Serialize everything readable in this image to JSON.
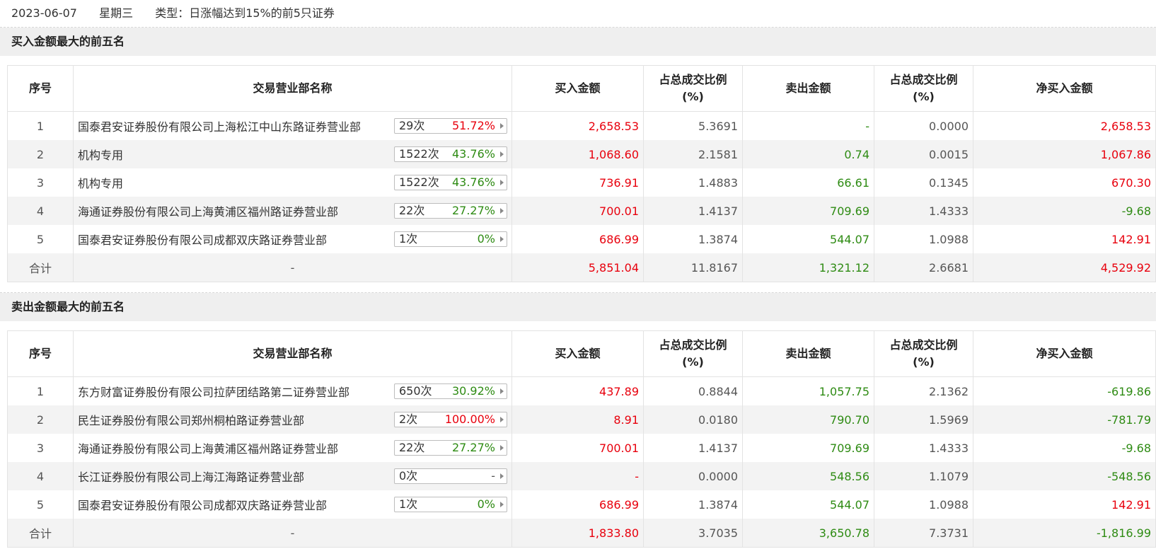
{
  "header": {
    "date": "2023-06-07",
    "weekday": "星期三",
    "type_label": "类型：日涨幅达到15%的前5只证券"
  },
  "columns": {
    "idx": "序号",
    "name": "交易营业部名称",
    "buy": "买入金额",
    "buy_ratio_1": "占总成交比例",
    "buy_ratio_2": "(%)",
    "sell": "卖出金额",
    "sell_ratio_1": "占总成交比例",
    "sell_ratio_2": "(%)",
    "net": "净买入金额"
  },
  "colors": {
    "up": "#e8000d",
    "down": "#2e8b13"
  },
  "buy_section": {
    "title": "买入金额最大的前五名",
    "rows": [
      {
        "idx": "1",
        "name": "国泰君安证券股份有限公司上海松江中山东路证券营业部",
        "count": "29次",
        "pct": "51.72%",
        "pct_color": "red",
        "buy": "2,658.53",
        "buy_ratio": "5.3691",
        "sell": "-",
        "sell_ratio": "0.0000",
        "net": "2,658.53",
        "net_color": "red"
      },
      {
        "idx": "2",
        "name": "机构专用",
        "count": "1522次",
        "pct": "43.76%",
        "pct_color": "green",
        "buy": "1,068.60",
        "buy_ratio": "2.1581",
        "sell": "0.74",
        "sell_ratio": "0.0015",
        "net": "1,067.86",
        "net_color": "red"
      },
      {
        "idx": "3",
        "name": "机构专用",
        "count": "1522次",
        "pct": "43.76%",
        "pct_color": "green",
        "buy": "736.91",
        "buy_ratio": "1.4883",
        "sell": "66.61",
        "sell_ratio": "0.1345",
        "net": "670.30",
        "net_color": "red"
      },
      {
        "idx": "4",
        "name": "海通证券股份有限公司上海黄浦区福州路证券营业部",
        "count": "22次",
        "pct": "27.27%",
        "pct_color": "green",
        "buy": "700.01",
        "buy_ratio": "1.4137",
        "sell": "709.69",
        "sell_ratio": "1.4333",
        "net": "-9.68",
        "net_color": "green"
      },
      {
        "idx": "5",
        "name": "国泰君安证券股份有限公司成都双庆路证券营业部",
        "count": "1次",
        "pct": "0%",
        "pct_color": "green",
        "buy": "686.99",
        "buy_ratio": "1.3874",
        "sell": "544.07",
        "sell_ratio": "1.0988",
        "net": "142.91",
        "net_color": "red"
      }
    ],
    "total": {
      "label": "合计",
      "name": "-",
      "buy": "5,851.04",
      "buy_ratio": "11.8167",
      "sell": "1,321.12",
      "sell_ratio": "2.6681",
      "net": "4,529.92",
      "net_color": "red"
    }
  },
  "sell_section": {
    "title": "卖出金额最大的前五名",
    "rows": [
      {
        "idx": "1",
        "name": "东方财富证券股份有限公司拉萨团结路第二证券营业部",
        "count": "650次",
        "pct": "30.92%",
        "pct_color": "green",
        "buy": "437.89",
        "buy_ratio": "0.8844",
        "sell": "1,057.75",
        "sell_ratio": "2.1362",
        "net": "-619.86",
        "net_color": "green"
      },
      {
        "idx": "2",
        "name": "民生证券股份有限公司郑州桐柏路证券营业部",
        "count": "2次",
        "pct": "100.00%",
        "pct_color": "red",
        "buy": "8.91",
        "buy_ratio": "0.0180",
        "sell": "790.70",
        "sell_ratio": "1.5969",
        "net": "-781.79",
        "net_color": "green"
      },
      {
        "idx": "3",
        "name": "海通证券股份有限公司上海黄浦区福州路证券营业部",
        "count": "22次",
        "pct": "27.27%",
        "pct_color": "green",
        "buy": "700.01",
        "buy_ratio": "1.4137",
        "sell": "709.69",
        "sell_ratio": "1.4333",
        "net": "-9.68",
        "net_color": "green"
      },
      {
        "idx": "4",
        "name": "长江证券股份有限公司上海江海路证券营业部",
        "count": "0次",
        "pct": "-",
        "pct_color": "gray",
        "buy": "-",
        "buy_ratio": "0.0000",
        "sell": "548.56",
        "sell_ratio": "1.1079",
        "net": "-548.56",
        "net_color": "green"
      },
      {
        "idx": "5",
        "name": "国泰君安证券股份有限公司成都双庆路证券营业部",
        "count": "1次",
        "pct": "0%",
        "pct_color": "green",
        "buy": "686.99",
        "buy_ratio": "1.3874",
        "sell": "544.07",
        "sell_ratio": "1.0988",
        "net": "142.91",
        "net_color": "red"
      }
    ],
    "total": {
      "label": "合计",
      "name": "-",
      "buy": "1,833.80",
      "buy_ratio": "3.7035",
      "sell": "3,650.78",
      "sell_ratio": "7.3731",
      "net": "-1,816.99",
      "net_color": "green"
    }
  }
}
